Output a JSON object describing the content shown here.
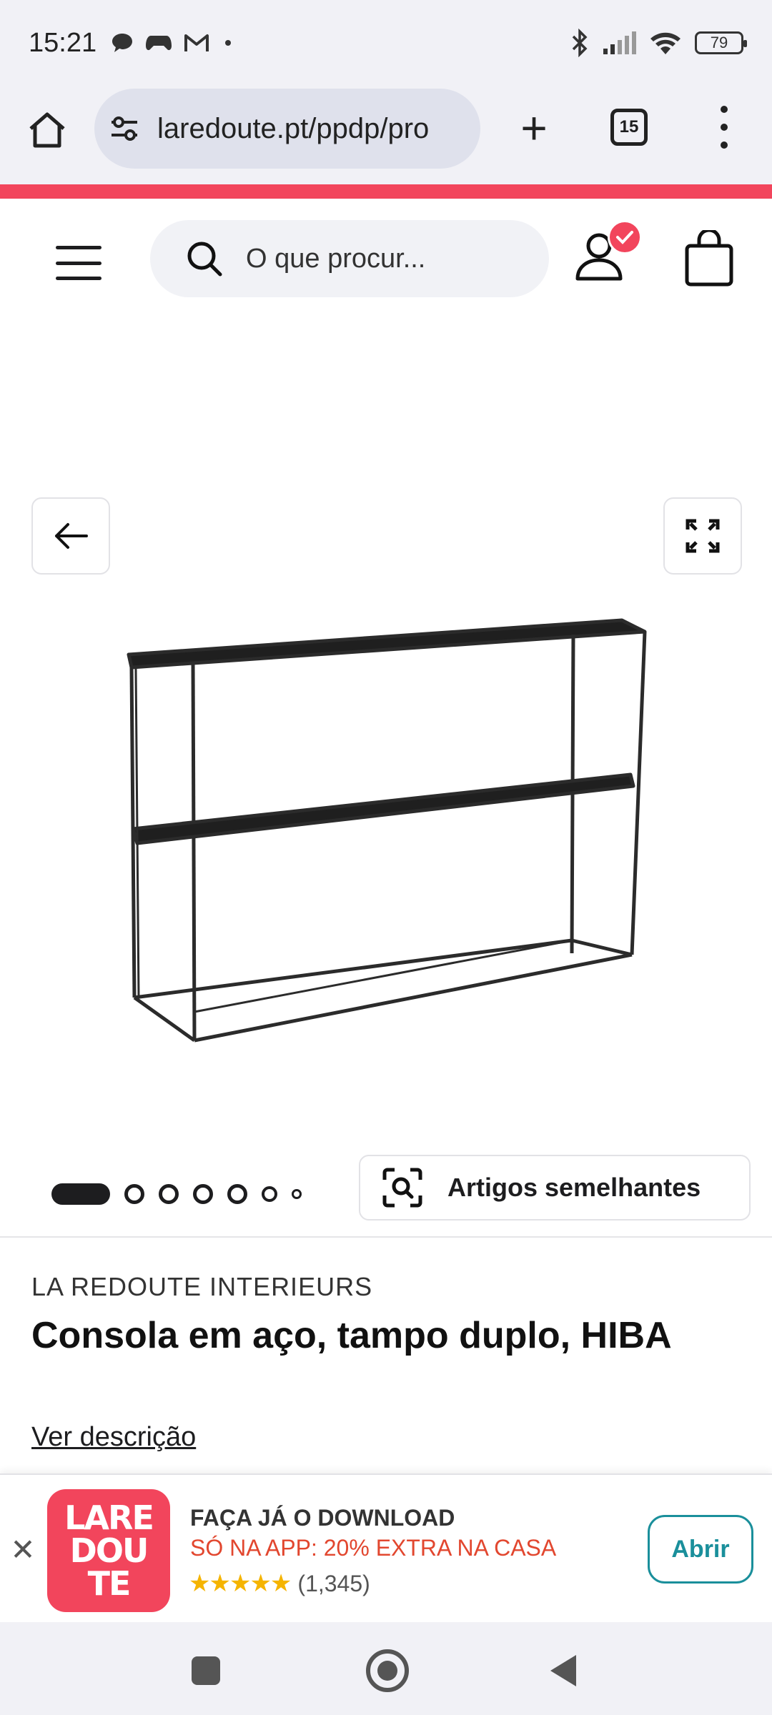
{
  "status_bar": {
    "time": "15:21",
    "battery": "79",
    "left_icons": [
      "chat-bubble-icon",
      "game-controller-icon",
      "gmail-icon",
      "dot-icon"
    ],
    "right_icons": [
      "bluetooth-icon",
      "signal-icon",
      "wifi-icon",
      "battery-icon"
    ]
  },
  "browser": {
    "url": "laredoute.pt/ppdp/pro",
    "tab_count": "15",
    "new_tab_label": "+"
  },
  "site_header": {
    "search_placeholder": "O que procur...",
    "accent_color": "#f2455c"
  },
  "gallery": {
    "image_count": 7,
    "active_index": 0,
    "similar_items_label": "Artigos semelhantes"
  },
  "product": {
    "brand": "LA REDOUTE INTERIEURS",
    "title": "Consola em aço, tampo duplo, HIBA",
    "description_link": "Ver descrição"
  },
  "app_banner": {
    "close_label": "✕",
    "logo_lines": [
      "LARE",
      "DOU",
      "TE"
    ],
    "title": "FAÇA JÁ O DOWNLOAD",
    "subtitle": "SÓ NA APP: 20% EXTRA NA CASA",
    "stars": "★★★★★",
    "rating_count": "(1,345)",
    "open_label": "Abrir"
  }
}
